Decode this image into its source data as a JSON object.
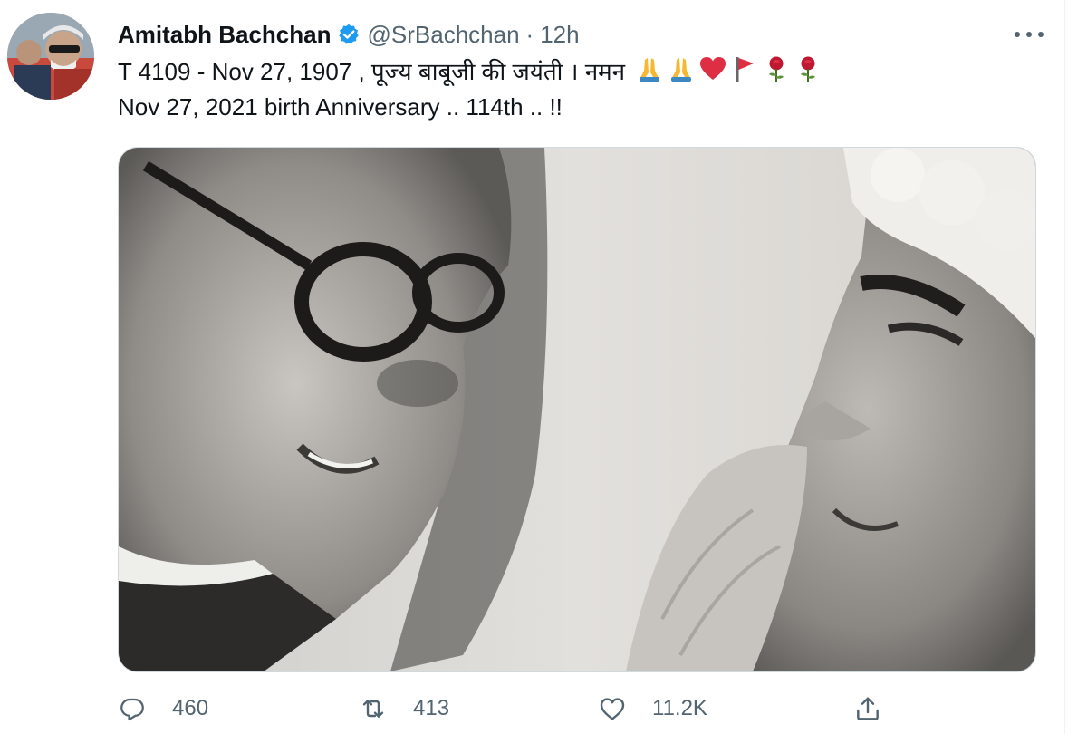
{
  "tweet": {
    "author": {
      "display_name": "Amitabh Bachchan",
      "handle": "@SrBachchan",
      "verified": true
    },
    "separator": "·",
    "time": "12h",
    "text_line1": "T 4109 - Nov 27,  1907 , पूज्य बाबूजी की जयंती  । नमन",
    "text_line2": "Nov 27, 2021 birth Anniversary .. 114th .. !!",
    "emojis": [
      "folded-hands-icon",
      "folded-hands-icon",
      "red-heart-icon",
      "red-flag-icon",
      "rose-icon",
      "rose-icon"
    ],
    "media": {
      "type": "black-and-white photograph"
    },
    "actions": {
      "reply_count": "460",
      "retweet_count": "413",
      "like_count": "11.2K"
    }
  },
  "icons": {
    "more": "more-horizontal-icon",
    "reply": "reply-bubble-icon",
    "retweet": "retweet-icon",
    "like": "heart-outline-icon",
    "share": "share-upload-icon"
  },
  "colors": {
    "text_primary": "#0f1419",
    "text_secondary": "#536471",
    "verified_blue": "#1d9bf0",
    "border": "#cfd9de"
  }
}
